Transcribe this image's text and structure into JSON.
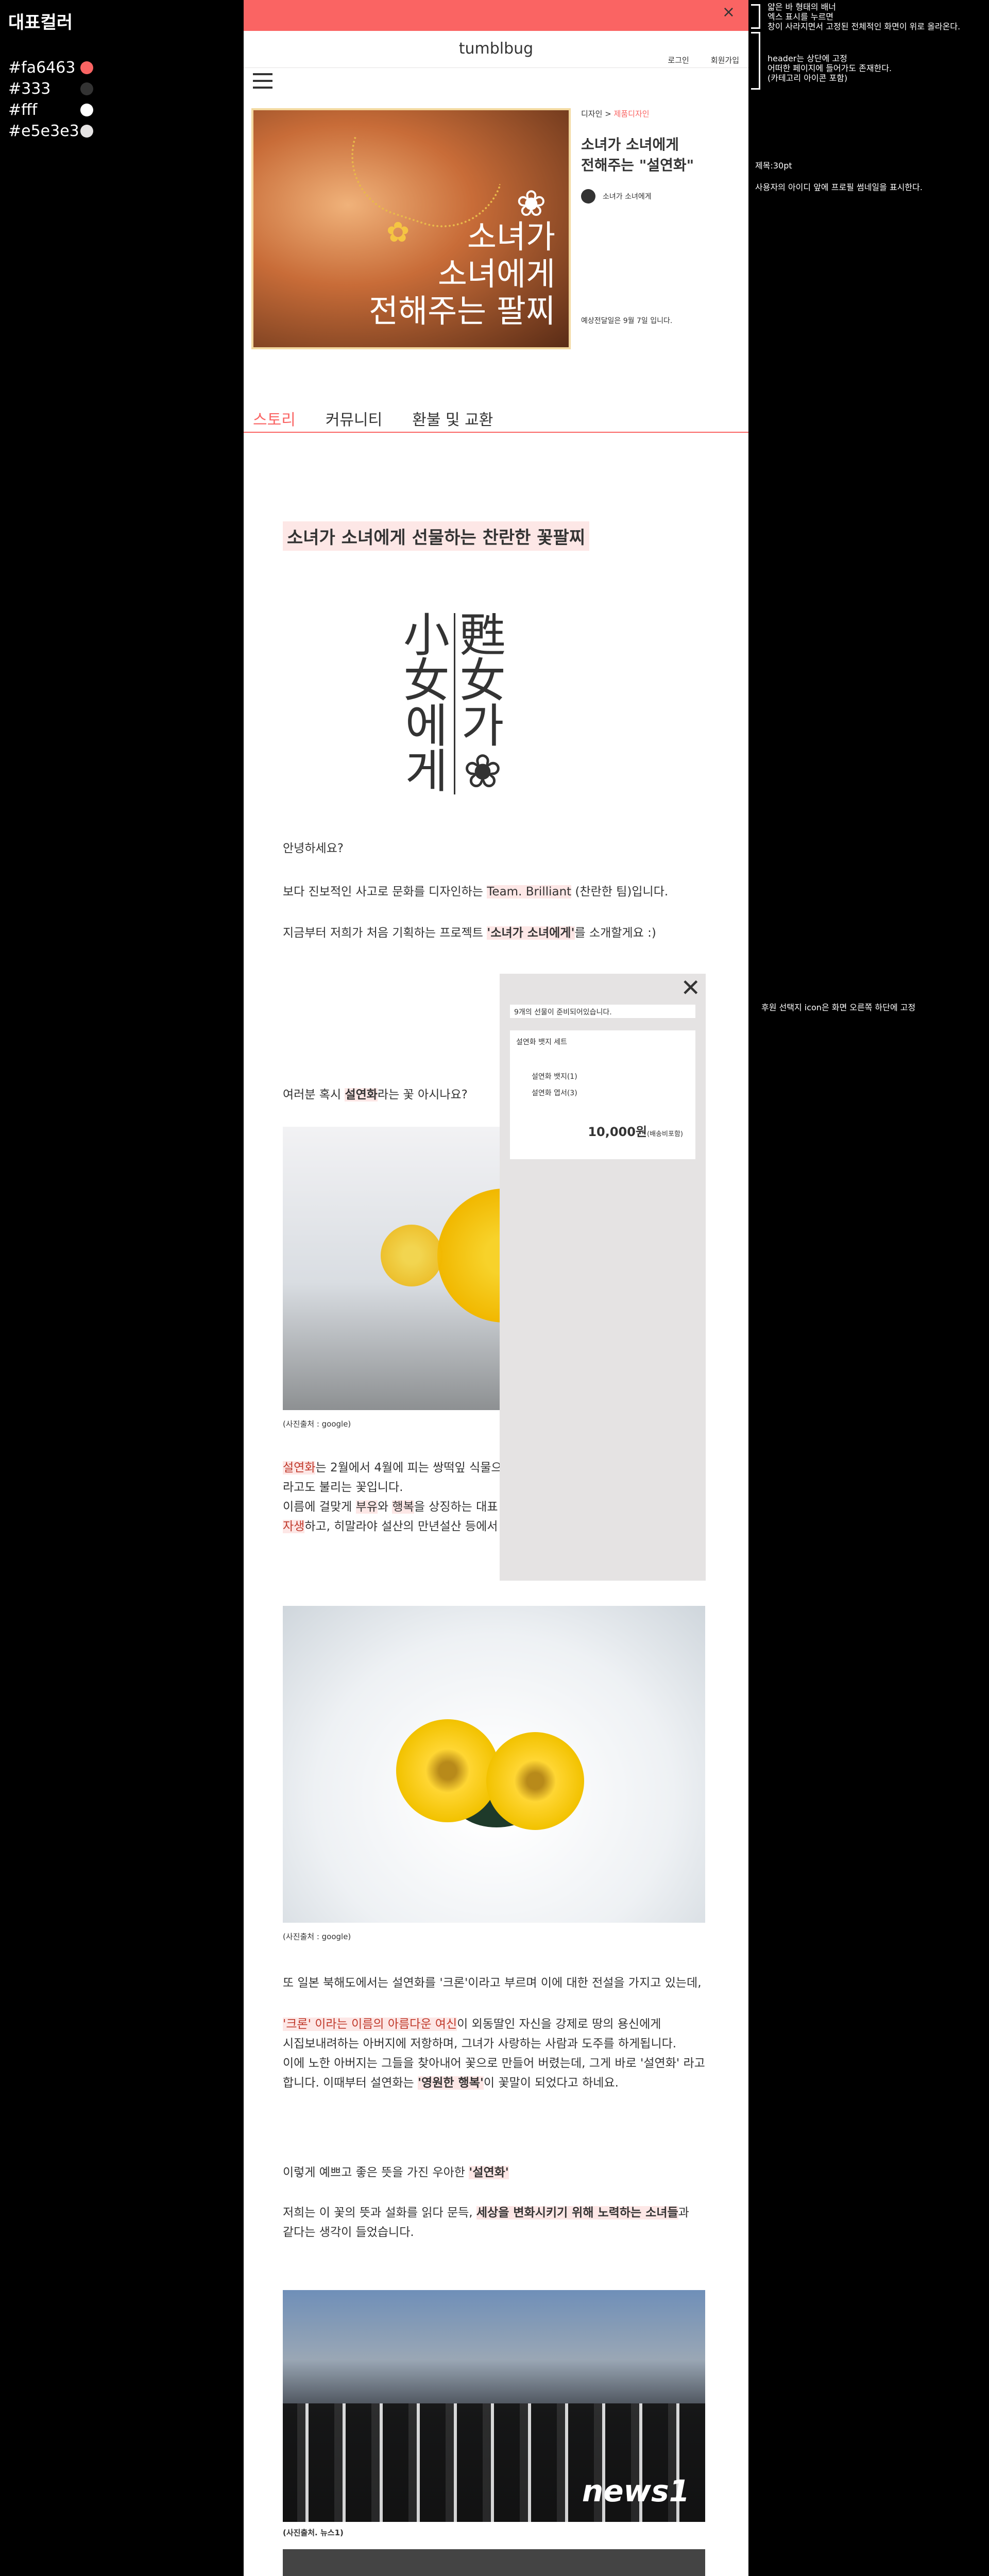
{
  "palette": {
    "title": "대표컬러",
    "swatches": [
      {
        "hex": "#fa6463",
        "color": "#fa6463"
      },
      {
        "hex": "#333",
        "color": "#333333"
      },
      {
        "hex": "#fff",
        "color": "#ffffff"
      },
      {
        "hex": "#e5e3e3",
        "color": "#e5e3e3"
      }
    ]
  },
  "notes": {
    "banner": "얇은 바 형태의 배너\n엑스 표시를 누르면\n창이 사라지면서 고정된 전체적인 화면이 위로 올라온다.",
    "header": "header는 상단에 고정\n어떠한 페이지에 들어가도 존재한다.\n(카테고리 아이콘 포함)",
    "title_size": "제목:30pt",
    "seller": "사용자의 아이디 앞에 프로필 썸네일을 표시한다.",
    "sponsor": "후원 선택지 icon은 화면 오른쪽 하단에 고정"
  },
  "banner": {
    "close_label": "×"
  },
  "header": {
    "brand": "tumblbug",
    "login": "로그인",
    "signup": "회원가입"
  },
  "product": {
    "image_text": [
      "소녀가",
      "소녀에게",
      "전해주는 팔찌"
    ],
    "breadcrumb_parent": "디자인",
    "breadcrumb_sep": ">",
    "breadcrumb_current": "제품디자인",
    "title_line1": "소녀가 소녀에게",
    "title_line2": "전해주는 \"설연화\"",
    "seller": "소녀가 소녀에게",
    "ship_date": "예상전달일은 9월 7일 입니다."
  },
  "tabs": [
    "스토리",
    "커뮤니티",
    "환불 및 교환"
  ],
  "story": {
    "headline": "소녀가 소녀에게 선물하는 찬란한 꽃팔찌",
    "logo_right": [
      "甦",
      "女",
      "가",
      "❀"
    ],
    "logo_left": [
      "小",
      "女",
      "에",
      "게"
    ],
    "greeting": "안녕하세요?",
    "intro_a": "보다 진보적인 사고로 문화를 디자인하는 ",
    "intro_team": "Team. Brilliant",
    "intro_b": " (찬란한 팀)입니다.",
    "project_a": "지금부터 저희가 처음 기획하는 프로젝트 ",
    "project_name": "'소녀가 소녀에게'",
    "project_b": "를 소개할게요 :)",
    "question_a": "여러분 혹시 ",
    "question_flower": "설연화",
    "question_b": "라는 꽃 아시나요?",
    "caption1": "(사진출처 : google)",
    "desc1_flower": "설연화",
    "desc1_a": "는 2월에서 4월에 피는 쌍떡잎 식물으",
    "desc2": "라고도 불리는 꽃입니다.",
    "desc3_a": "이름에 걸맞게 ",
    "desc3_b": "부유",
    "desc3_c": "와 ",
    "desc3_d": "행복",
    "desc3_e": "을 상징하는 대표",
    "desc4_a": "자생",
    "desc4_b": "하고, 히말라야 설산의 만년설산 등에서",
    "caption2": "(사진출처 : google)",
    "legend1": "또 일본 북해도에서는 설연화를 '크론'이라고 부르며 이에 대한 전설을 가지고 있는데,",
    "legend2_hl": "'크론' 이라는 이름의 아름다운 여신",
    "legend2_b": "이 외동딸인 자신을 강제로 땅의 용신에게",
    "legend3": "시집보내려하는 아버지에 저항하며, 그녀가 사랑하는 사람과 도주를 하게됩니다.",
    "legend4": "이에 노한 아버지는 그들을 찾아내어 꽃으로 만들어 버렸는데, 그게 바로 '설연화' 라고",
    "legend5_a": "합니다. 이때부터 설연화는 ",
    "legend5_hl": "'영원한 행복'",
    "legend5_b": "이 꽃말이 되었다고 하네요.",
    "meaning_a": "이렇게 예쁘고 좋은 뜻을 가진 우아한 ",
    "meaning_hl": "'설연화'",
    "girls1_a": "저희는 이 꽃의 뜻과 설화를 읽다 문득, ",
    "girls1_hl": "세상을 변화시키기 위해 노력하는 소녀들",
    "girls1_b": "과",
    "girls2": "같다는 생각이 들었습니다.",
    "photo3_logo": "news1",
    "caption3": "(사진출처. 뉴스1)"
  },
  "sponsor": {
    "close_label": "✕",
    "notice": "9개의 선물이 준비되어있습니다.",
    "set_name": "설연화 뱃지 세트",
    "items": [
      "설연화 뱃지(1)",
      "설연화 엽서(3)"
    ],
    "price": "10,000원",
    "price_note": "(배송비포함)"
  }
}
